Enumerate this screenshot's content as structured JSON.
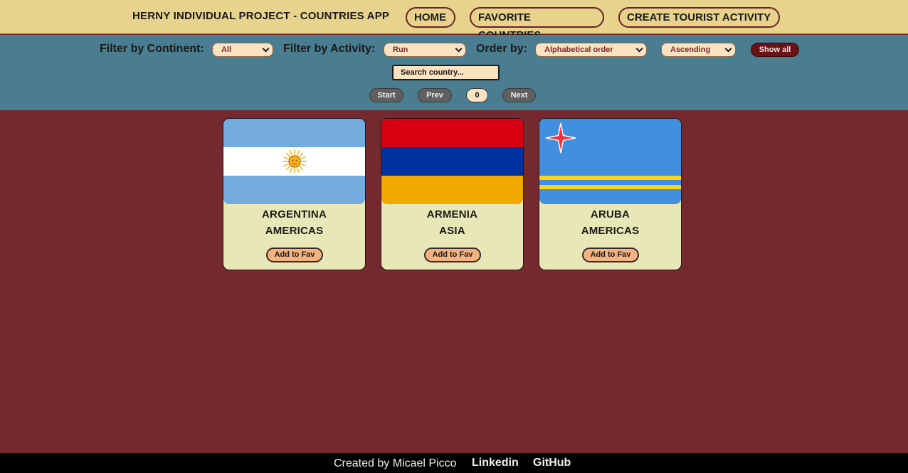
{
  "header": {
    "title": "HERNY INDIVIDUAL PROJECT - COUNTRIES APP",
    "nav": {
      "home": "HOME",
      "favorites": "FAVORITE COUNTRIES",
      "create": "CREATE TOURIST ACTIVITY"
    }
  },
  "filters": {
    "continent_label": "Filter by Continent:",
    "continent_value": "All",
    "activity_label": "Filter by Activity:",
    "activity_value": "Run",
    "order_label": "Order by:",
    "order_value": "Alphabetical order",
    "direction_value": "Ascending",
    "show_all": "Show all",
    "search_placeholder": "Search country..."
  },
  "pagination": {
    "start": "Start",
    "prev": "Prev",
    "page": "0",
    "next": "Next"
  },
  "countries": [
    {
      "name": "ARGENTINA",
      "continent": "AMERICAS",
      "button": "Add to Fav",
      "flag": "argentina-flag"
    },
    {
      "name": "ARMENIA",
      "continent": "ASIA",
      "button": "Add to Fav",
      "flag": "armenia-flag"
    },
    {
      "name": "ARUBA",
      "continent": "AMERICAS",
      "button": "Add to Fav",
      "flag": "aruba-flag"
    }
  ],
  "footer": {
    "credit": "Created by Micael Picco",
    "linkedin": "Linkedin",
    "github": "GitHub"
  },
  "colors": {
    "nav_bg": "#e8d38c",
    "filter_bg": "#4a7d90",
    "page_bg": "#73292e",
    "card_bg": "#e8e7b8",
    "footer_bg": "#000000"
  }
}
